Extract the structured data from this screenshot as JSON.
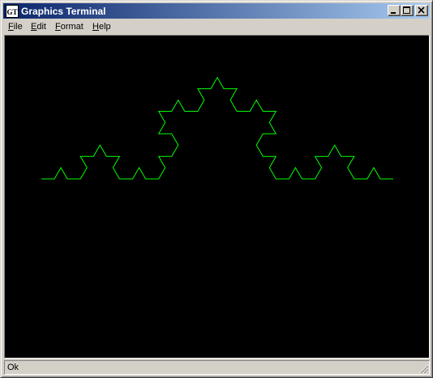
{
  "window": {
    "title": "Graphics Terminal",
    "icon": "graphics-terminal-app-icon",
    "icon_glyph": "GT"
  },
  "menu": {
    "items": [
      {
        "label": "File",
        "mnemonic": "F",
        "rest": "ile"
      },
      {
        "label": "Edit",
        "mnemonic": "E",
        "rest": "dit"
      },
      {
        "label": "Format",
        "mnemonic": "F",
        "rest": "ormat"
      },
      {
        "label": "Help",
        "mnemonic": "H",
        "rest": "elp"
      }
    ]
  },
  "canvas": {
    "background": "#000000",
    "stroke_color": "#00ff00",
    "drawing": "koch-curve"
  },
  "status": {
    "text": "Ok"
  },
  "colors": {
    "titlebar_start": "#0a246a",
    "titlebar_end": "#a6caf0",
    "chrome": "#d4d0c8"
  }
}
